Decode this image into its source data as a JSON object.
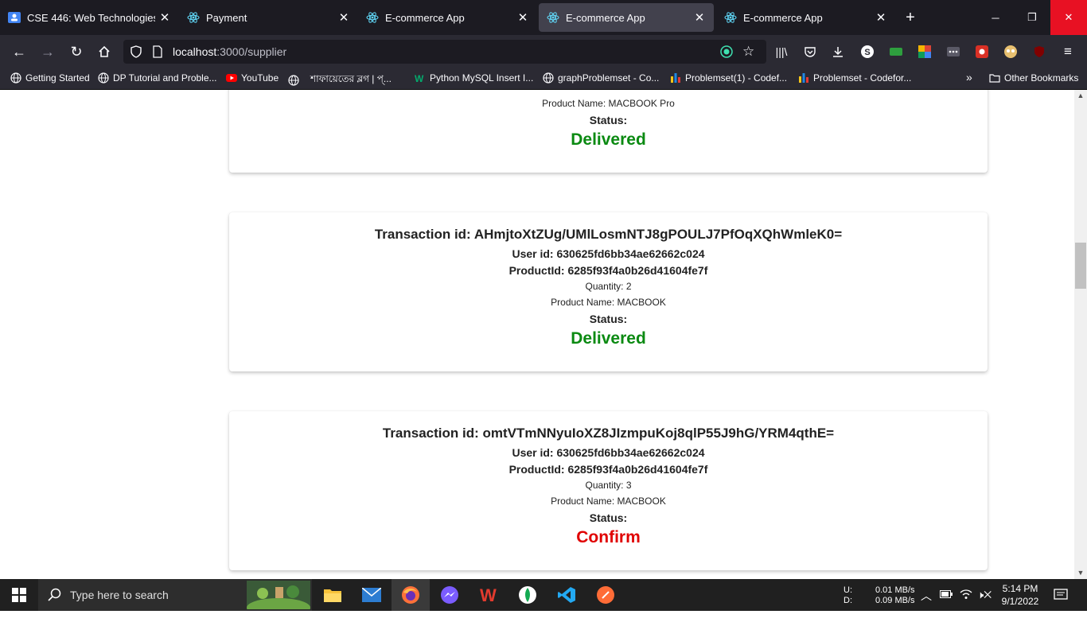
{
  "tabs": [
    {
      "label": "CSE 446: Web Technologies",
      "icon": "classroom-icon"
    },
    {
      "label": "Payment",
      "icon": "react-icon"
    },
    {
      "label": "E-commerce App",
      "icon": "react-icon"
    },
    {
      "label": "E-commerce App",
      "icon": "react-icon",
      "active": true
    },
    {
      "label": "E-commerce App",
      "icon": "react-icon"
    }
  ],
  "url": {
    "host": "localhost",
    "path": ":3000/supplier"
  },
  "bookmarks": [
    "Getting Started",
    "DP Tutorial and Proble...",
    "YouTube",
    "শাফায়েতের ব্লগ | প্...",
    "Python MySQL Insert I...",
    "graphProblemset - Co...",
    "Problemset(1) - Codef...",
    "Problemset - Codefor...",
    "Other Bookmarks"
  ],
  "cards": [
    {
      "product_name": "Product Name: MACBOOK Pro",
      "status_label": "Status:",
      "status_value": "Delivered"
    },
    {
      "transaction": "Transaction id: AHmjtoXtZUg/UMlLosmNTJ8gPOULJ7PfOqXQhWmleK0=",
      "user_id": "User id: 630625fd6bb34ae62662c024",
      "product_id": "ProductId: 6285f93f4a0b26d41604fe7f",
      "quantity": "Quantity: 2",
      "product_name": "Product Name: MACBOOK",
      "status_label": "Status:",
      "status_value": "Delivered"
    },
    {
      "transaction": "Transaction id: omtVTmNNyuIoXZ8JIzmpuKoj8qlP55J9hG/YRM4qthE=",
      "user_id": "User id: 630625fd6bb34ae62662c024",
      "product_id": "ProductId: 6285f93f4a0b26d41604fe7f",
      "quantity": "Quantity: 3",
      "product_name": "Product Name: MACBOOK",
      "status_label": "Status:",
      "status_value": "Confirm"
    }
  ],
  "colors": {
    "delivered": "#0b8a12",
    "confirm": "#e00000",
    "firefox_tab_bg": "#1c1b22"
  },
  "taskbar": {
    "search_placeholder": "Type here to search",
    "net_up_label": "U:",
    "net_down_label": "D:",
    "net_up": "0.01 MB/s",
    "net_down": "0.09 MB/s",
    "time": "5:14 PM",
    "date": "9/1/2022"
  }
}
